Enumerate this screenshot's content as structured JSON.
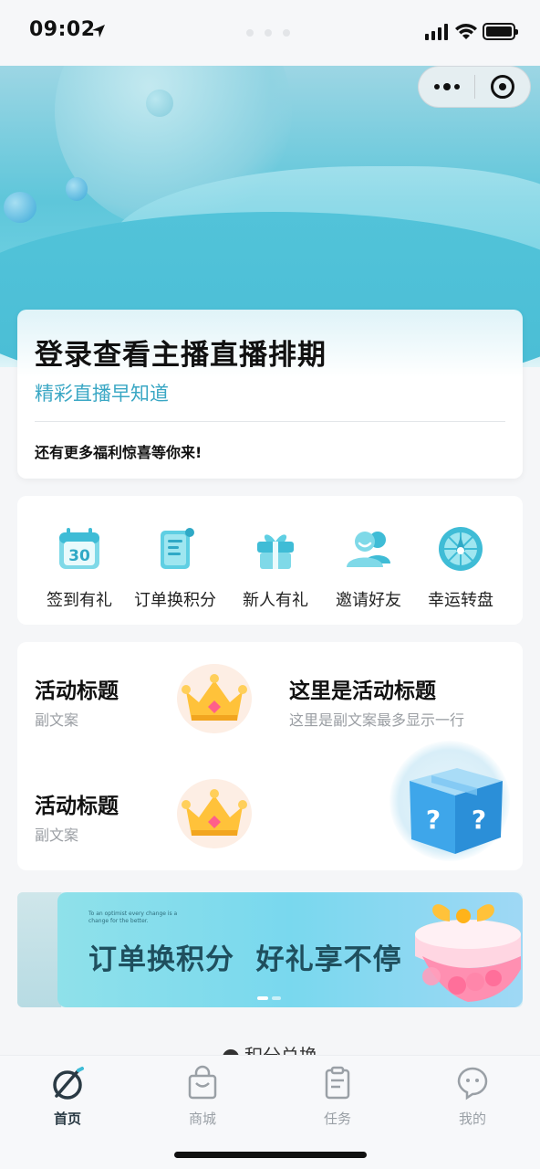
{
  "status_bar": {
    "time": "09:02"
  },
  "capsule": {
    "more_icon": "more-dots-icon",
    "close_icon": "target-circle-icon"
  },
  "login_card": {
    "title": "登录查看主播直播排期",
    "subtitle": "精彩直播早知道",
    "note": "还有更多福利惊喜等你来!"
  },
  "quick_actions": [
    {
      "label": "签到有礼",
      "icon": "calendar-icon",
      "calendar_day": "30"
    },
    {
      "label": "订单换积分",
      "icon": "scroll-order-icon"
    },
    {
      "label": "新人有礼",
      "icon": "gift-icon"
    },
    {
      "label": "邀请好友",
      "icon": "friends-icon"
    },
    {
      "label": "幸运转盘",
      "icon": "lucky-wheel-icon"
    }
  ],
  "activities": [
    {
      "title": "活动标题",
      "subtitle": "副文案",
      "icon": "crown-icon"
    },
    {
      "title": "这里是活动标题",
      "subtitle": "这里是副文案最多显示一行"
    },
    {
      "title": "活动标题",
      "subtitle": "副文案",
      "icon": "crown-icon"
    },
    {
      "icon": "mystery-box-icon"
    }
  ],
  "banner": {
    "tagline": "To an optimist every change is a change for the better.",
    "headline": "订单换积分  好礼享不停",
    "slides": 2,
    "active_slide": 1
  },
  "section": {
    "title": "积分兑换"
  },
  "tabbar": [
    {
      "label": "首页",
      "icon": "home-logo-icon",
      "active": true
    },
    {
      "label": "商城",
      "icon": "shopping-bag-icon",
      "active": false
    },
    {
      "label": "任务",
      "icon": "clipboard-icon",
      "active": false
    },
    {
      "label": "我的",
      "icon": "chat-face-icon",
      "active": false
    }
  ],
  "colors": {
    "accent": "#3aa7c4",
    "active_tab": "#2a3a44",
    "inactive_tab": "#9aa0a6"
  }
}
